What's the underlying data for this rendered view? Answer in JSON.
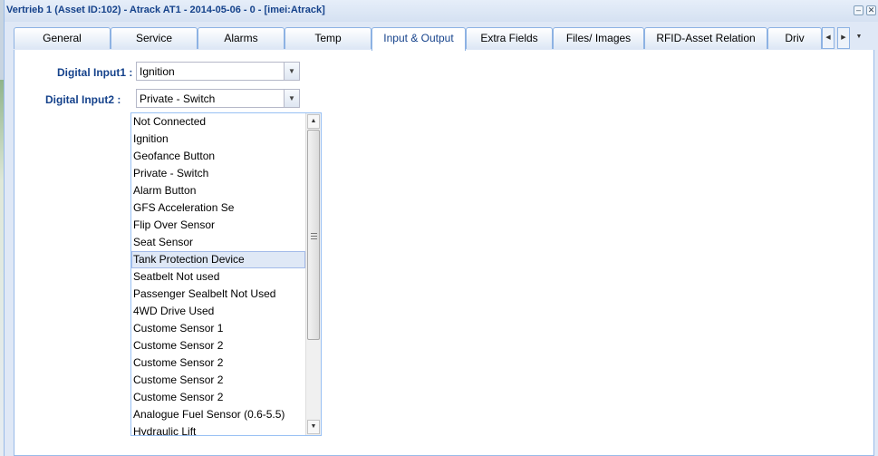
{
  "window": {
    "title": "Vertrieb 1 (Asset ID:102) - Atrack AT1 - 2014-05-06 - 0 - [imei:Atrack]",
    "minimize_icon": "minimize-icon",
    "close_icon": "close-icon"
  },
  "tabs": [
    {
      "label": "General"
    },
    {
      "label": "Service"
    },
    {
      "label": "Alarms"
    },
    {
      "label": "Temp"
    },
    {
      "label": "Input & Output",
      "active": true
    },
    {
      "label": "Extra Fields"
    },
    {
      "label": "Files/ Images"
    },
    {
      "label": "RFID-Asset Relation"
    },
    {
      "label": "Driv"
    }
  ],
  "form": {
    "digital_input1": {
      "label": "Digital Input1 :",
      "value": "Ignition"
    },
    "digital_input2": {
      "label": "Digital Input2 :",
      "value": "Private - Switch"
    }
  },
  "dropdown": {
    "highlighted": "Tank Protection Device",
    "options": [
      "Not Connected",
      "Ignition",
      "Geofance Button",
      "Private - Switch",
      "Alarm Button",
      "GFS Acceleration Se",
      "Flip Over Sensor",
      "Seat Sensor",
      "Tank Protection Device",
      "Seatbelt Not used",
      "Passenger Sealbelt Not Used",
      "4WD Drive Used",
      "Custome Sensor 1",
      "Custome Sensor 2",
      "Custome Sensor 2",
      "Custome Sensor 2",
      "Custome Sensor 2",
      "Analogue Fuel Sensor (0.6-5.5)",
      "Hydraulic Lift"
    ]
  },
  "colors": {
    "accent": "#15428b",
    "border": "#99bbe8",
    "highlight": "#dfe8f6"
  }
}
